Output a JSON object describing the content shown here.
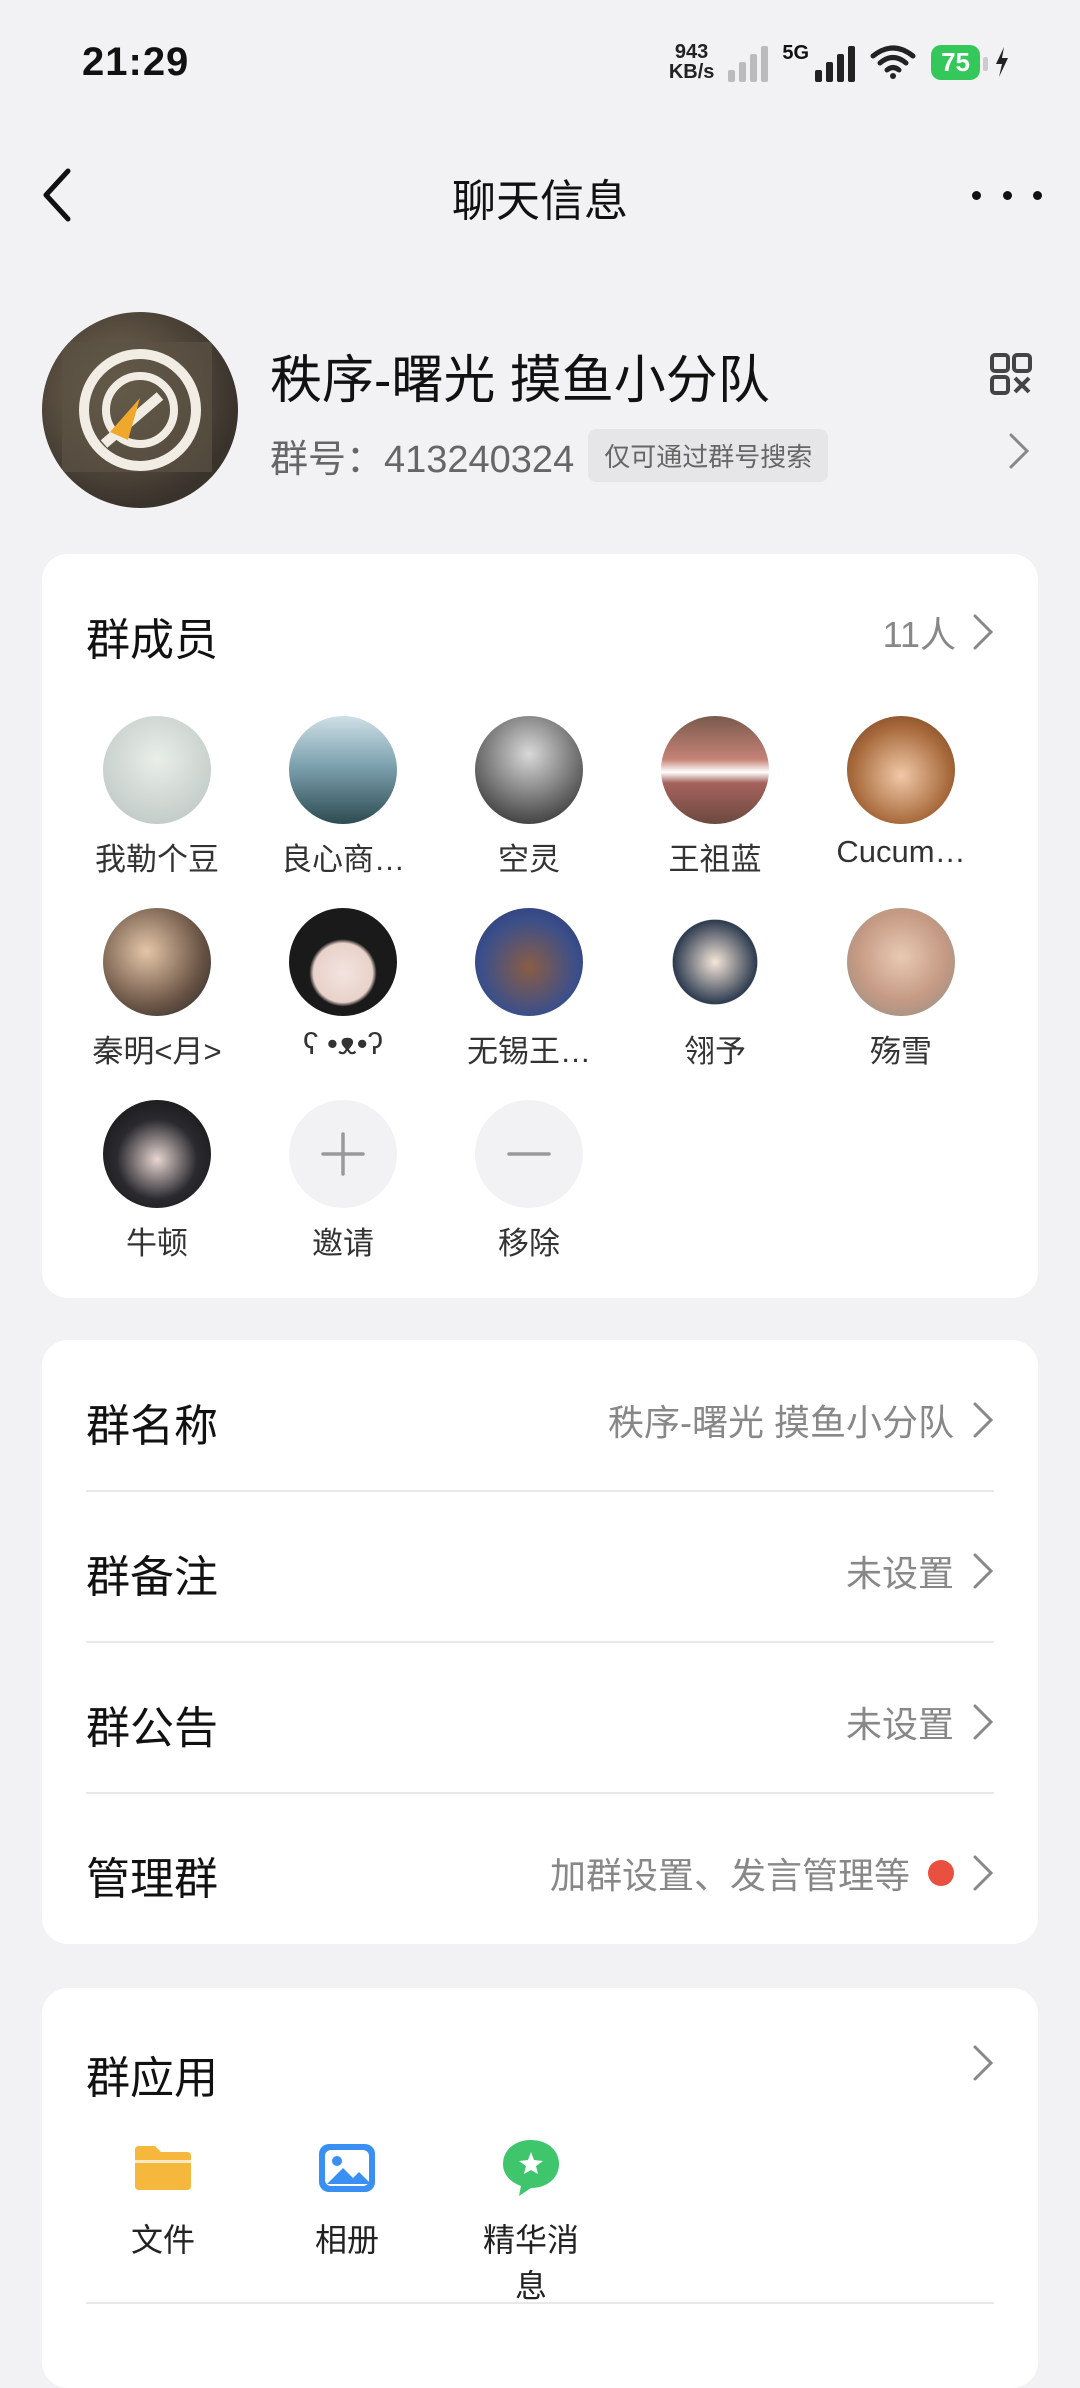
{
  "status_bar": {
    "time": "21:29",
    "net_speed_value": "943",
    "net_speed_unit": "KB/s",
    "network": "5G",
    "battery": "75"
  },
  "header": {
    "title": "聊天信息"
  },
  "group": {
    "name": "秩序-曙光 摸鱼小分队",
    "id_label": "群号：413240324",
    "search_tag": "仅可通过群号搜索"
  },
  "members": {
    "title": "群成员",
    "count": "11人",
    "list": [
      {
        "name": "我勒个豆"
      },
      {
        "name": "良心商…"
      },
      {
        "name": "空灵"
      },
      {
        "name": "王祖蓝"
      },
      {
        "name": "Cucum…"
      },
      {
        "name": "秦明<月>"
      },
      {
        "name": "ʕ •ᴥ•ʔ"
      },
      {
        "name": "无锡王…"
      },
      {
        "name": "翎予"
      },
      {
        "name": "殇雪"
      },
      {
        "name": "牛顿"
      }
    ],
    "invite_label": "邀请",
    "remove_label": "移除"
  },
  "settings": [
    {
      "label": "群名称",
      "value": "秩序-曙光 摸鱼小分队"
    },
    {
      "label": "群备注",
      "value": "未设置"
    },
    {
      "label": "群公告",
      "value": "未设置"
    },
    {
      "label": "管理群",
      "value": "加群设置、发言管理等"
    }
  ],
  "apps": {
    "title": "群应用",
    "items": [
      {
        "label": "文件"
      },
      {
        "label": "相册"
      },
      {
        "label": "精华消息"
      }
    ]
  },
  "colors": {
    "accent_green": "#34c759",
    "badge_red": "#e9503f",
    "folder_yellow": "#f5b83d",
    "album_blue": "#3a8ff2",
    "essence_green": "#3fc56b"
  }
}
